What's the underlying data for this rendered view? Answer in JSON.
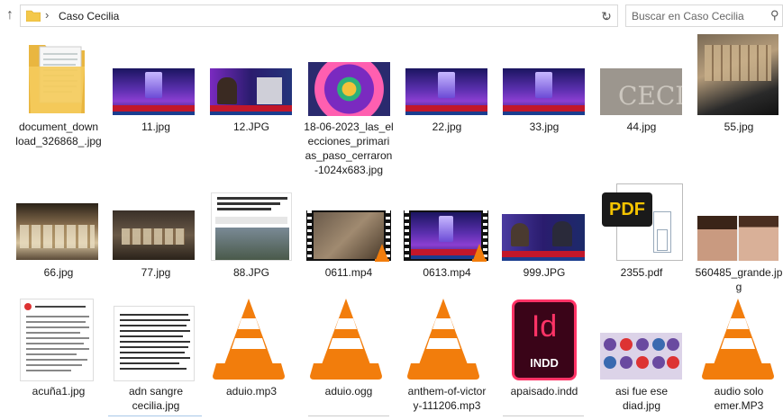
{
  "address_bar": {
    "path_current": "Caso Cecilia",
    "separator": "›",
    "search_placeholder": "Buscar en Caso Cecilia"
  },
  "files": [
    {
      "name": "document_download_326868_.jpg",
      "type": "folder-doc"
    },
    {
      "name": "11.jpg",
      "type": "tv"
    },
    {
      "name": "12.JPG",
      "type": "tv-people"
    },
    {
      "name": "18-06-2023_las_elecciones_primarias_paso_cerraron-1024x683.jpg",
      "type": "colorful"
    },
    {
      "name": "22.jpg",
      "type": "tv"
    },
    {
      "name": "33.jpg",
      "type": "tv"
    },
    {
      "name": "44.jpg",
      "type": "ground"
    },
    {
      "name": "55.jpg",
      "type": "money"
    },
    {
      "name": "66.jpg",
      "type": "money2"
    },
    {
      "name": "77.jpg",
      "type": "money2"
    },
    {
      "name": "88.JPG",
      "type": "article"
    },
    {
      "name": "0611.mp4",
      "type": "video"
    },
    {
      "name": "0613.mp4",
      "type": "video-tv"
    },
    {
      "name": "999.JPG",
      "type": "tv-people"
    },
    {
      "name": "2355.pdf",
      "type": "pdf"
    },
    {
      "name": "560485_grande.jpg",
      "type": "portrait"
    },
    {
      "name": "acuña1.jpg",
      "type": "doc"
    },
    {
      "name": "adn sangre cecilia.jpg",
      "type": "doc2"
    },
    {
      "name": "aduio.mp3",
      "type": "vlc"
    },
    {
      "name": "aduio.ogg",
      "type": "vlc"
    },
    {
      "name": "anthem-of-victory-111206.mp3",
      "type": "vlc"
    },
    {
      "name": "apaisado.indd",
      "type": "indd"
    },
    {
      "name": "asi fue ese diad.jpg",
      "type": "infographic"
    },
    {
      "name": "audio solo emer.MP3",
      "type": "vlc"
    }
  ],
  "labels": {
    "f0": "document_down\nload_326868_.jpg",
    "f3": "18-06-2023_las_el\necciones_primari\nas_paso_cerraron\n-1024x683.jpg",
    "f15": "560485_grande.jp\ng",
    "f17": "adn sangre\ncecilia.jpg",
    "f20": "anthem-of-victor\ny-111206.mp3",
    "f22": "asi fue ese\ndiad.jpg",
    "f23": "audio solo\nemer.MP3"
  },
  "pdf_badge": "PDF",
  "indd_badge": {
    "big": "Id",
    "small": "INDD"
  },
  "colors": {
    "vlc_orange": "#f27d0c",
    "tv_purple": "#6b2fc1",
    "pdf_yellow": "#f5c400",
    "indd_pink": "#ff3366"
  }
}
